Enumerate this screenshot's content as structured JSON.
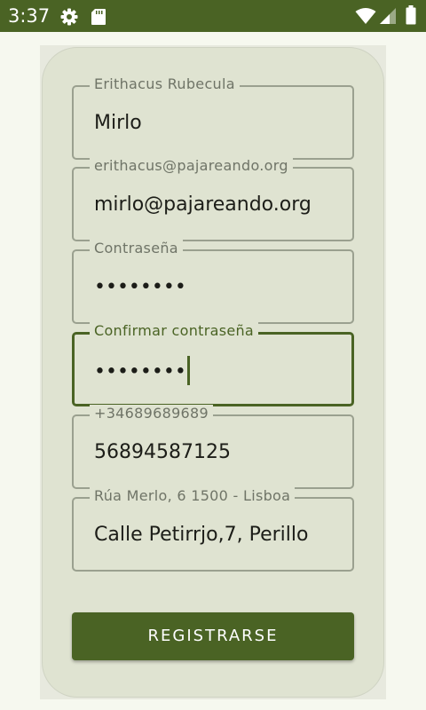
{
  "status_bar": {
    "time": "3:37",
    "left_icons": [
      "gear-icon",
      "sd-card-icon"
    ],
    "right_icons": [
      "wifi-icon",
      "cell-signal-icon",
      "battery-icon"
    ]
  },
  "form": {
    "fields": [
      {
        "label": "Erithacus Rubecula",
        "value": "Mirlo",
        "focused": false
      },
      {
        "label": "erithacus@pajareando.org",
        "value": "mirlo@pajareando.org",
        "focused": false
      },
      {
        "label": "Contraseña",
        "value": "••••••••",
        "focused": false
      },
      {
        "label": "Confirmar contraseña",
        "value": "••••••••",
        "focused": true
      },
      {
        "label": "+34689689689",
        "value": "56894587125",
        "focused": false
      },
      {
        "label": "Rúa Merlo, 6 1500 - Lisboa",
        "value": "Calle Petirrjo,7, Perillo",
        "focused": false
      }
    ],
    "submit_label": "REGISTRARSE"
  },
  "colors": {
    "primary": "#4a6324",
    "card": "#dfe3d1",
    "background": "#f6f8ef",
    "outline": "#9aa08f"
  }
}
